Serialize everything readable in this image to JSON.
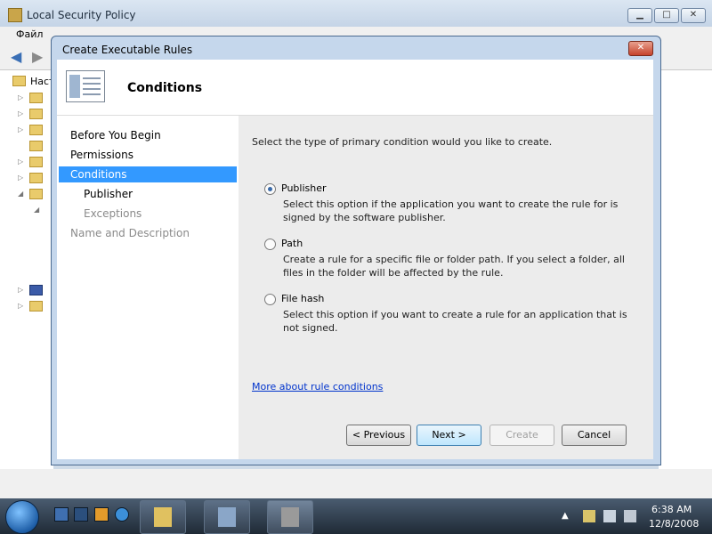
{
  "background_window": {
    "title": "Local Security Policy",
    "menu_file": "Файл",
    "tree_root_label": "Наст"
  },
  "dialog": {
    "title": "Create Executable Rules",
    "close_glyph": "✕",
    "header_title": "Conditions",
    "steps": [
      {
        "label": "Before You Begin",
        "state": "normal"
      },
      {
        "label": "Permissions",
        "state": "normal"
      },
      {
        "label": "Conditions",
        "state": "active"
      },
      {
        "label": "Publisher",
        "state": "sub"
      },
      {
        "label": "Exceptions",
        "state": "sub-disabled"
      },
      {
        "label": "Name and Description",
        "state": "disabled"
      }
    ],
    "prompt": "Select the type of primary condition would you like to create.",
    "options": [
      {
        "title": "Publisher",
        "selected": true,
        "desc": "Select this option if the application you want to create the rule for is signed by the software publisher."
      },
      {
        "title": "Path",
        "selected": false,
        "desc": "Create a rule for a specific file or folder path. If you select a folder, all files in the folder will be affected by the rule."
      },
      {
        "title": "File hash",
        "selected": false,
        "desc": "Select this option if you want to create a rule for an application that is not signed."
      }
    ],
    "more_link": "More about rule conditions",
    "buttons": {
      "previous": "< Previous",
      "next": "Next >",
      "create": "Create",
      "cancel": "Cancel"
    }
  },
  "taskbar": {
    "time": "6:38 AM",
    "date": "12/8/2008",
    "tray_arrow": "▲"
  },
  "colors": {
    "selection": "#3399ff",
    "link": "#0033cc",
    "disabled_text": "#8a8a8a"
  }
}
